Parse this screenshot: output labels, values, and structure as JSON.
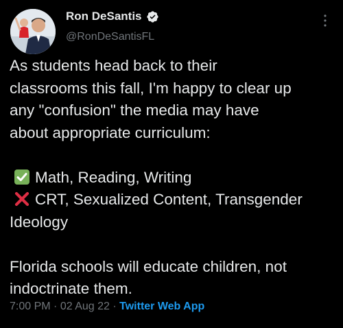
{
  "author": {
    "display_name": "Ron DeSantis",
    "handle": "@RonDeSantisFL",
    "verified": true,
    "avatar_icon": "profile-photo"
  },
  "tweet": {
    "lines": [
      "As students head back to their",
      "classrooms this fall, I'm happy to clear up",
      "any \"confusion\" the media may have",
      "about appropriate curriculum:"
    ],
    "allowed": {
      "icon": "check-mark-button-icon",
      "text": "Math, Reading, Writing"
    },
    "rejected": {
      "icon": "cross-mark-icon",
      "text_line1": "CRT, Sexualized Content, Transgender",
      "text_line2": "Ideology"
    },
    "closing_lines": [
      "Florida schools will educate children, not",
      "indoctrinate them."
    ]
  },
  "meta": {
    "time": "7:00 PM",
    "separator": "·",
    "date": "02 Aug 22",
    "source": "Twitter Web App"
  },
  "colors": {
    "background": "#000000",
    "text": "#e7e9ea",
    "secondary": "#71767b",
    "link": "#1d9bf0",
    "verified": "#1d9bf0",
    "check_green": "#78b159",
    "cross_red": "#dd2e44"
  }
}
